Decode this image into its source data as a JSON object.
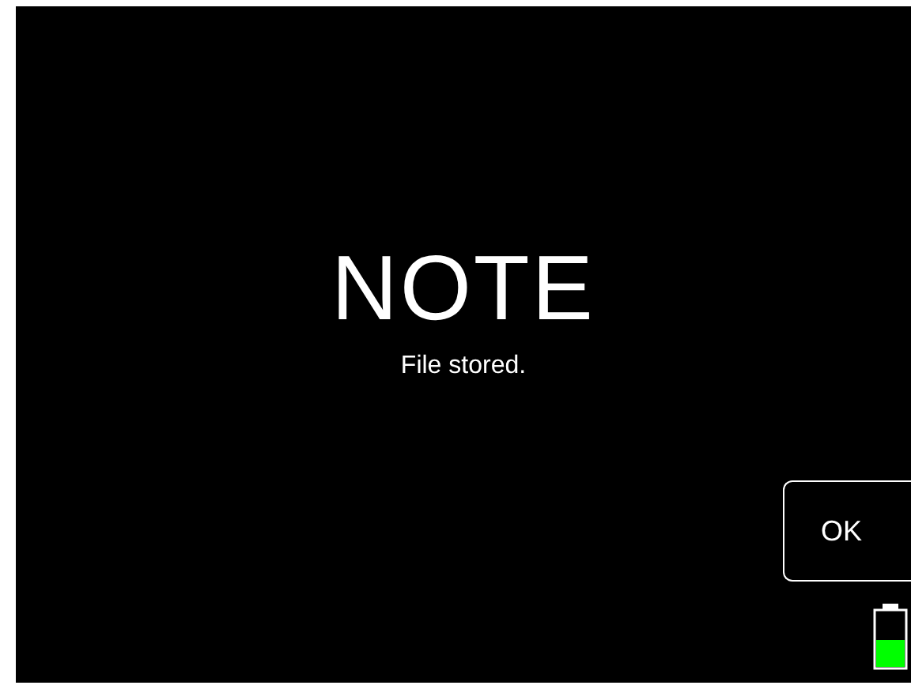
{
  "dialog": {
    "title": "NOTE",
    "message": "File stored."
  },
  "buttons": [
    "OK"
  ]
}
